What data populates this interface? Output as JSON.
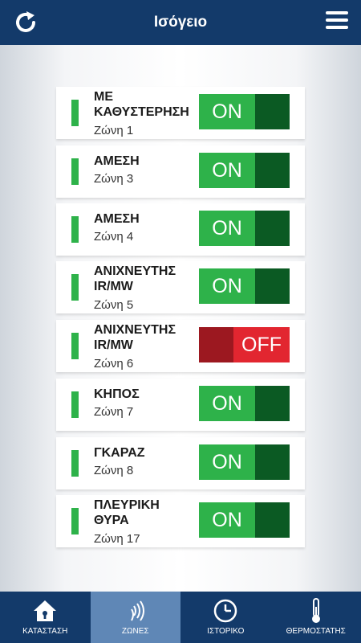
{
  "header": {
    "title": "Ισόγειο"
  },
  "zones": [
    {
      "name": "ΜΕ ΚΑΘΥΣΤΕΡΗΣΗ",
      "sub": "Ζώνη 1",
      "state": "ON"
    },
    {
      "name": "ΑΜΕΣΗ",
      "sub": "Ζώνη 3",
      "state": "ON"
    },
    {
      "name": "ΑΜΕΣΗ",
      "sub": "Ζώνη 4",
      "state": "ON"
    },
    {
      "name": "ΑΝΙΧΝΕΥΤΗΣ IR/MW",
      "sub": "Ζώνη 5",
      "state": "ON"
    },
    {
      "name": "ΑΝΙΧΝΕΥΤΗΣ IR/MW",
      "sub": "Ζώνη 6",
      "state": "OFF"
    },
    {
      "name": "ΚΗΠΟΣ",
      "sub": "Ζώνη 7",
      "state": "ON"
    },
    {
      "name": "ΓΚΑΡΑΖ",
      "sub": "Ζώνη 8",
      "state": "ON"
    },
    {
      "name": "ΠΛΕΥΡΙΚΗ ΘΥΡΑ",
      "sub": "Ζώνη 17",
      "state": "ON"
    }
  ],
  "nav": [
    {
      "label": "ΚΑΤΑΣΤΑΣΗ",
      "icon": "home-icon",
      "active": false
    },
    {
      "label": "ΖΩΝΕΣ",
      "icon": "wireless-icon",
      "active": true
    },
    {
      "label": "ΙΣΤΟΡΙΚΟ",
      "icon": "clock-icon",
      "active": false
    },
    {
      "label": "ΘΕΡΜΟΣΤΑΤΗΣ",
      "icon": "thermometer-icon",
      "active": false
    }
  ],
  "colors": {
    "header": "#133a6a",
    "on": "#2eb24a",
    "on_knob": "#0b5a23",
    "off": "#e22630",
    "off_knob": "#9c1820",
    "nav_active": "#5f87b6"
  }
}
